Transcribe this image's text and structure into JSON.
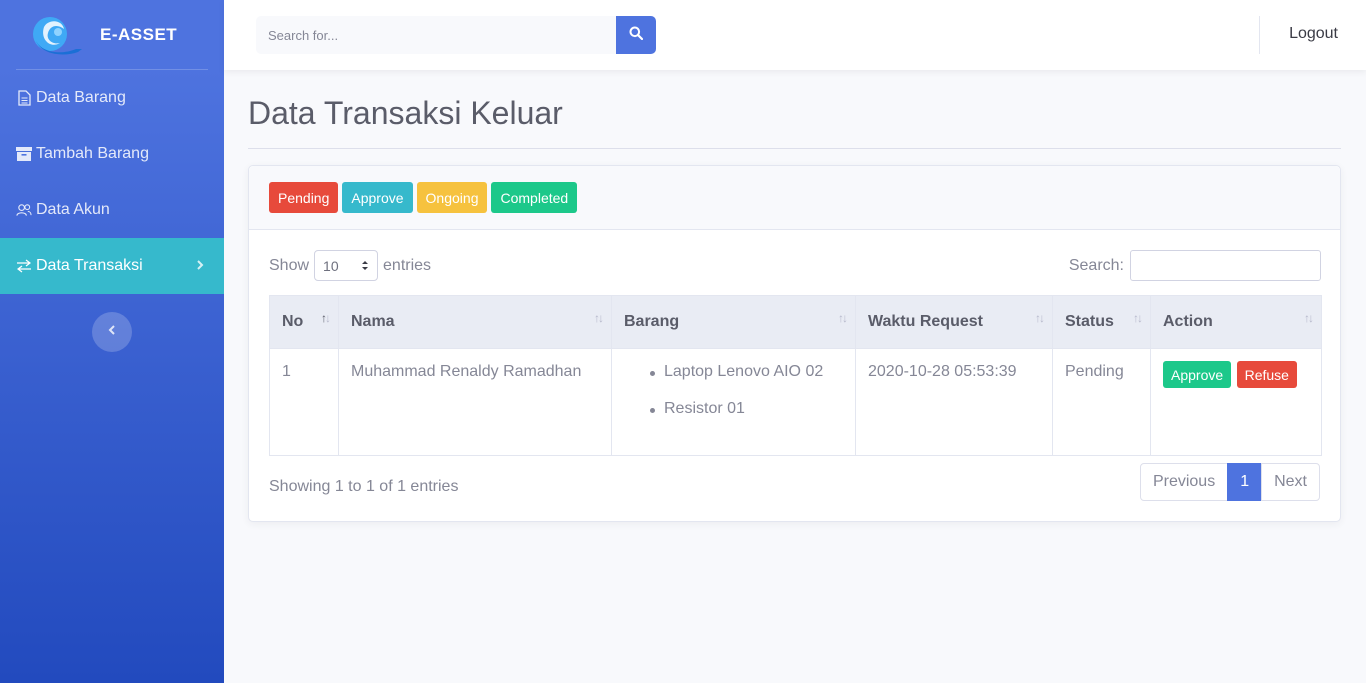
{
  "brand": {
    "name": "E-ASSET"
  },
  "sidebar": {
    "items": [
      {
        "label": "Data Barang",
        "icon": "file-icon"
      },
      {
        "label": "Tambah Barang",
        "icon": "archive-icon"
      },
      {
        "label": "Data Akun",
        "icon": "users-icon"
      },
      {
        "label": "Data Transaksi",
        "icon": "exchange-icon",
        "active": true
      }
    ]
  },
  "topbar": {
    "search_placeholder": "Search for...",
    "logout_label": "Logout"
  },
  "page": {
    "title": "Data Transaksi Keluar"
  },
  "filters": {
    "pending": "Pending",
    "approve": "Approve",
    "ongoing": "Ongoing",
    "completed": "Completed"
  },
  "datatable": {
    "show_label": "Show",
    "entries_label": "entries",
    "page_length": "10",
    "search_label": "Search:",
    "columns": [
      "No",
      "Nama",
      "Barang",
      "Waktu Request",
      "Status",
      "Action"
    ],
    "rows": [
      {
        "no": "1",
        "nama": "Muhammad Renaldy Ramadhan",
        "barang": [
          "Laptop Lenovo AIO 02",
          "Resistor 01"
        ],
        "waktu": "2020-10-28 05:53:39",
        "status": "Pending",
        "approve_label": "Approve",
        "refuse_label": "Refuse"
      }
    ],
    "info": "Showing 1 to 1 of 1 entries",
    "pager": {
      "previous": "Previous",
      "current": "1",
      "next": "Next"
    }
  },
  "colors": {
    "primary": "#4e73df",
    "info": "#36b9cc",
    "danger": "#e74a3b",
    "warning": "#f6c23e",
    "success": "#1cc88a"
  }
}
